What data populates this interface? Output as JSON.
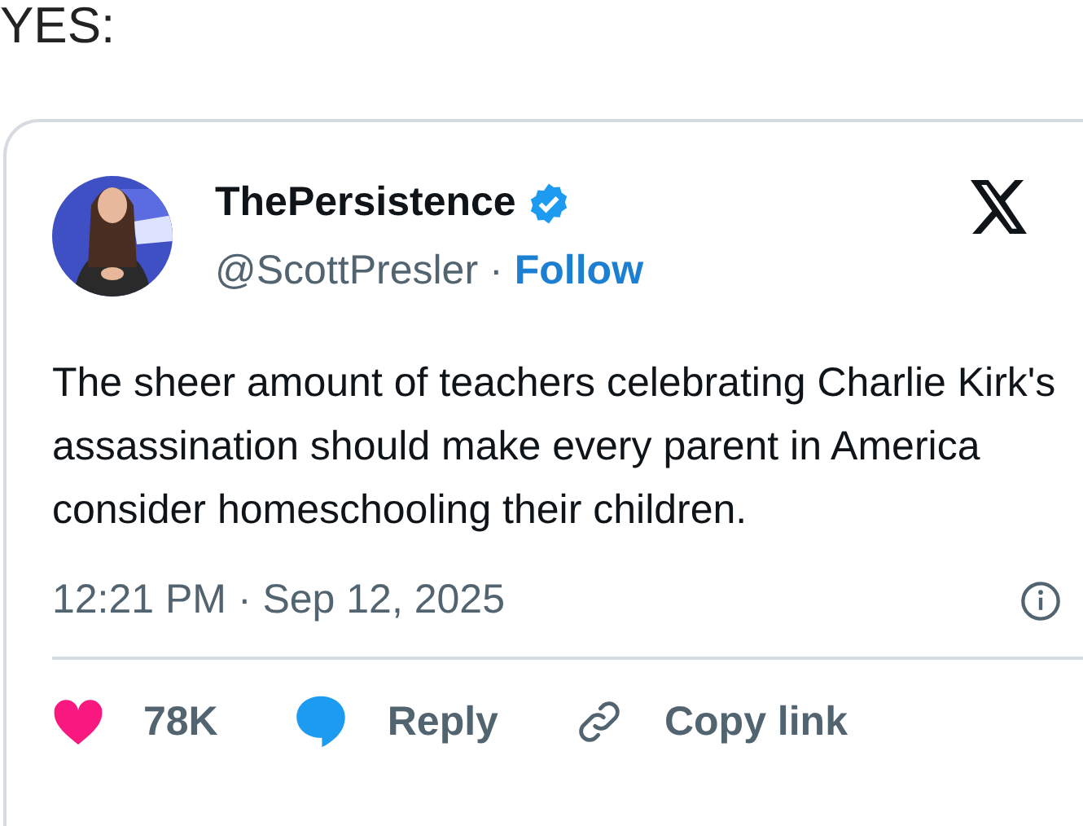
{
  "caption": "YES:",
  "tweet": {
    "display_name": "ThePersistence",
    "verified": true,
    "handle": "@ScottPresler",
    "separator": "·",
    "follow": "Follow",
    "text": "The sheer amount of teachers celebrating Charlie Kirk's assassination should make every parent in America consider homeschooling their children.",
    "timestamp": "12:21 PM · Sep 12, 2025",
    "actions": [
      {
        "kind": "like",
        "label": "78K"
      },
      {
        "kind": "reply",
        "label": "Reply"
      },
      {
        "kind": "copy",
        "label": "Copy link"
      }
    ]
  }
}
